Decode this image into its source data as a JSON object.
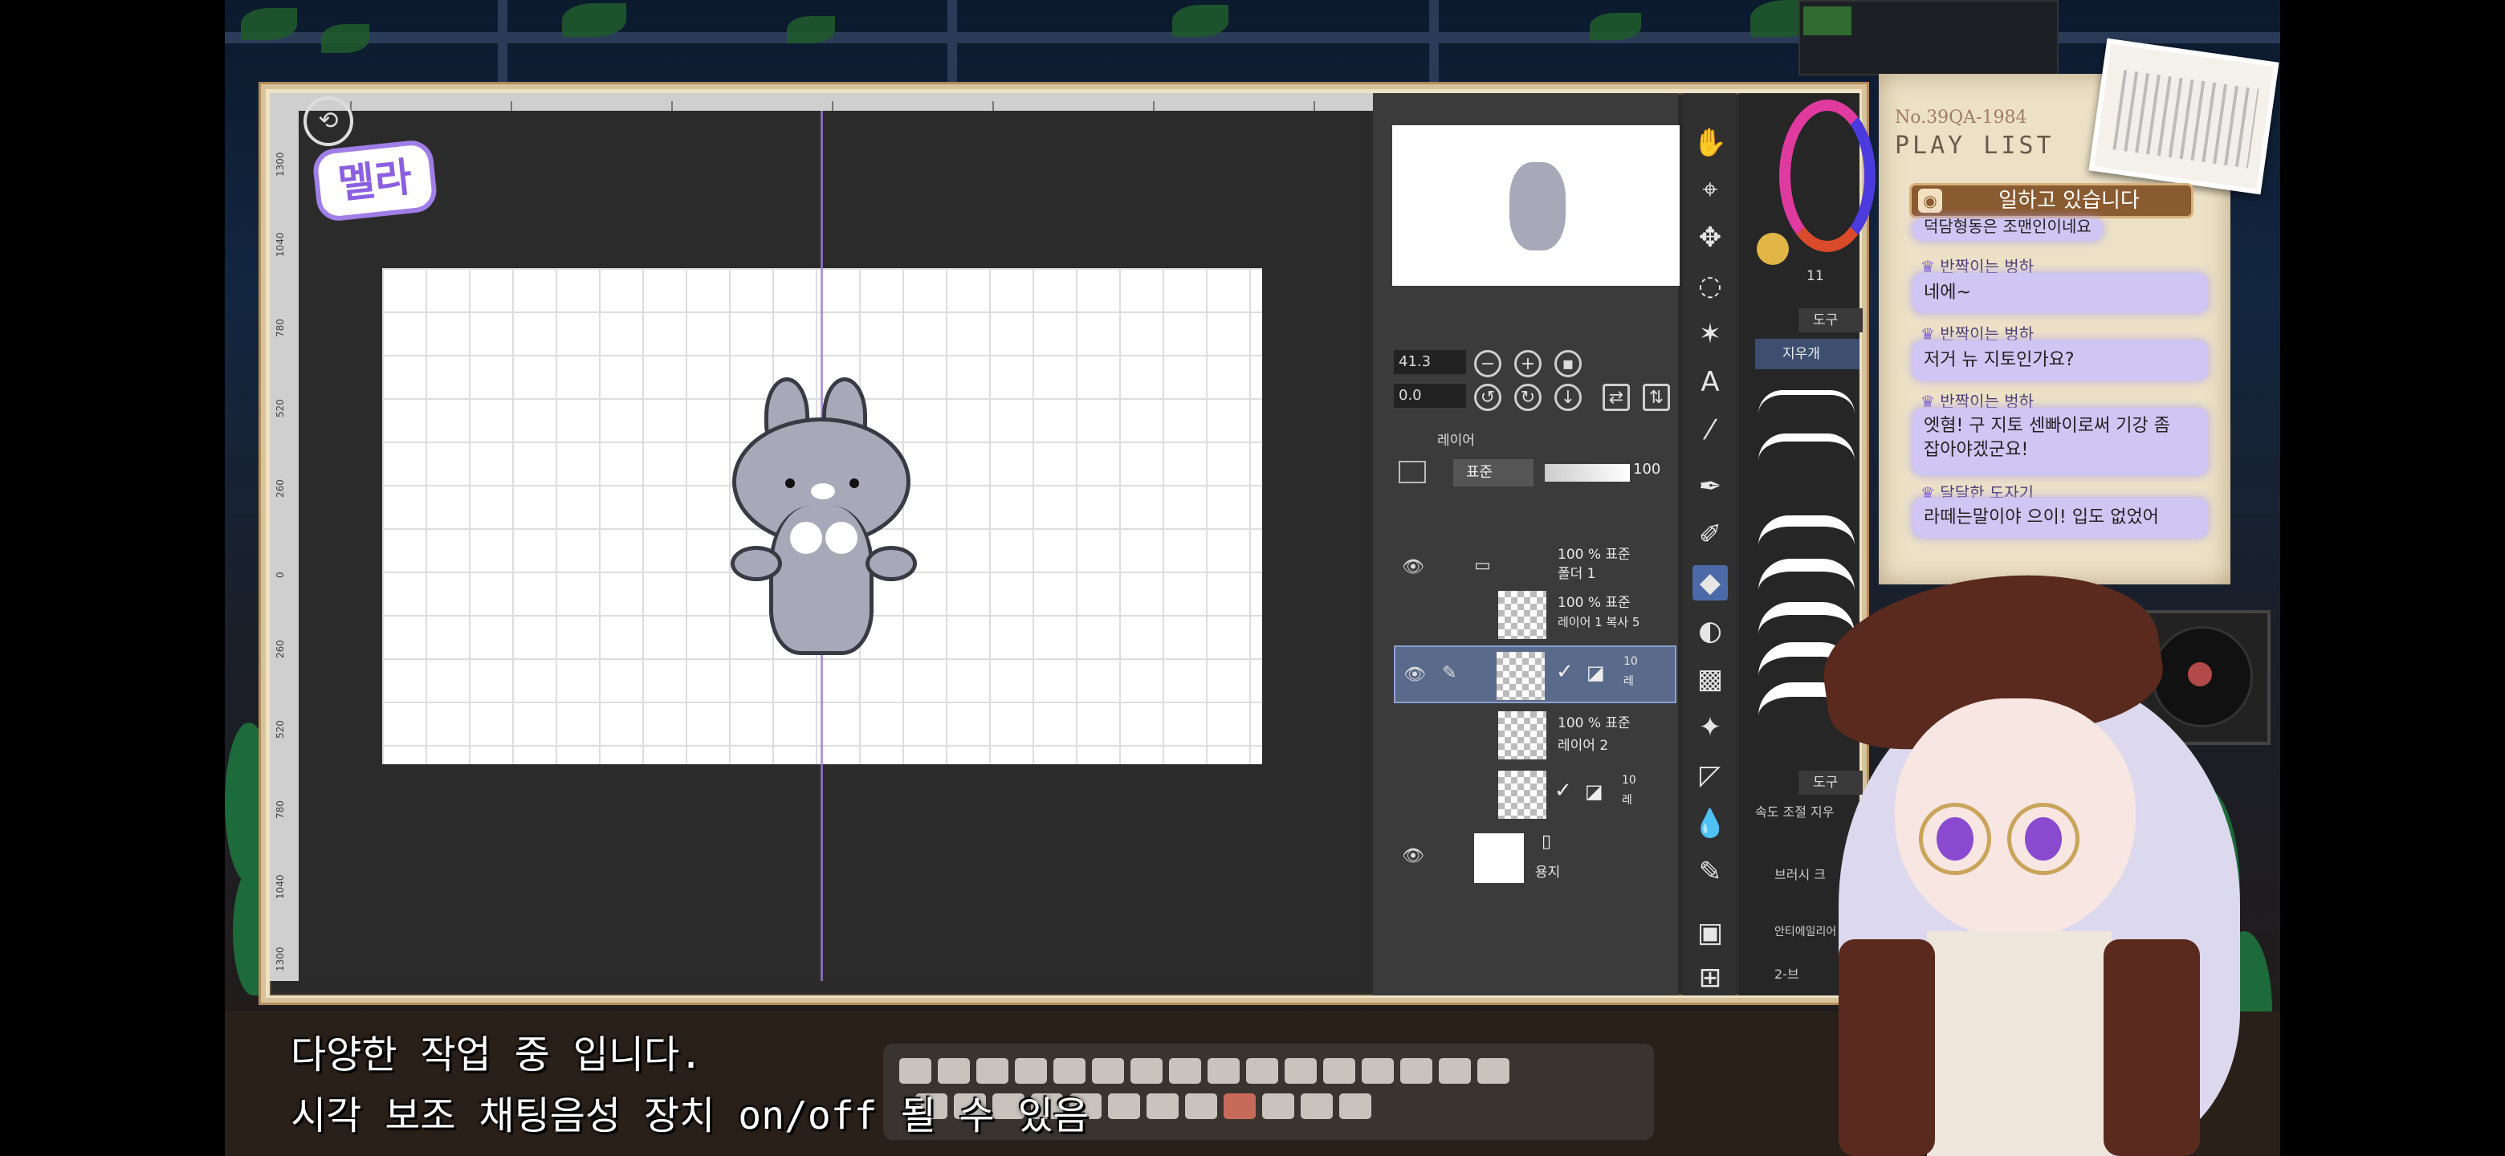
{
  "streamer_logo": "멜라",
  "canvas_ruler": {
    "left_labels": [
      "1300",
      "1040",
      "780",
      "520",
      "260",
      "0",
      "260",
      "520",
      "780",
      "1040",
      "1300"
    ]
  },
  "navigator": {
    "zoom": "41.3",
    "rotation": "0.0"
  },
  "layer_panel": {
    "title": "레이어",
    "blend_mode": "표준",
    "opacity": "100",
    "layers": [
      {
        "line1": "100 % 표준",
        "line2": "폴더 1",
        "visible": true
      },
      {
        "line1": "100 % 표준",
        "line2": "레이어 1 복사 5",
        "visible": false
      },
      {
        "line1": "10",
        "line2": "레",
        "visible": true,
        "selected": true
      },
      {
        "line1": "100 % 표준",
        "line2": "레이어 2",
        "visible": false
      },
      {
        "line1": "10",
        "line2": "레",
        "visible": false
      },
      {
        "line1": "",
        "line2": "용지",
        "visible": true
      }
    ]
  },
  "brush_panel": {
    "tab1": "도구",
    "active_tool": "지우개",
    "tab2": "도구",
    "setting1": "속도 조절 지우",
    "setting2": "브러시 크",
    "setting3": "안티에일리어",
    "setting4": "2-브",
    "color_value": "11"
  },
  "playlist": {
    "number": "No.39QA-1984",
    "title": "PLAY LIST",
    "status": "일하고 있습니다",
    "cut_message": "덕담형동은 조맨인이네요",
    "messages": [
      {
        "user": "반짝이는 벙하",
        "text": "네에~"
      },
      {
        "user": "반짝이는 벙하",
        "text": "저거 뉴 지토인가요?"
      },
      {
        "user": "반짝이는 벙하",
        "text": "엣혐! 구 지토 센빠이로써 기강 좀",
        "text2": "잡아야겠군요!"
      },
      {
        "user": "달달한 도자기",
        "text": "라떼는말이야 으이! 입도 없었어"
      }
    ]
  },
  "subtitles": {
    "line1": "다양한 작업 중 입니다.",
    "line2": "시각 보조 채팅음성 장치 on/off 될 수 있음"
  },
  "colors": {
    "accent_purple": "#9b7ed6",
    "chat_bubble": "#cfc6f4",
    "frame": "#efe2c4"
  }
}
